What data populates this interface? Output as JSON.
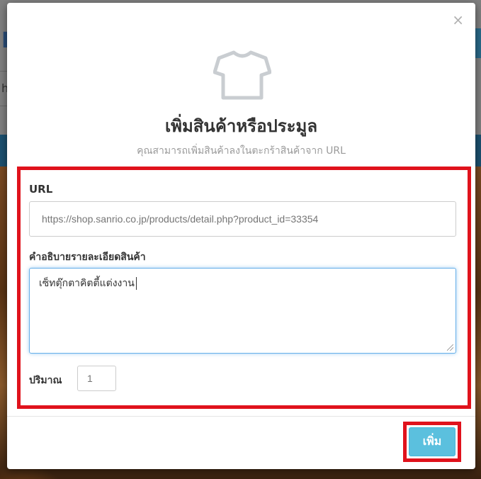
{
  "background": {
    "logo_letter": "F",
    "search_letter": "h"
  },
  "modal": {
    "close_label": "×",
    "icon": "tshirt-icon",
    "title": "เพิ่มสินค้าหรือประมูล",
    "subtitle": "คุณสามารถเพิ่มสินค้าลงในตะกร้าสินค้าจาก URL",
    "url_label": "URL",
    "url_placeholder": "https://shop.sanrio.co.jp/products/detail.php?product_id=33354",
    "desc_label": "คำอธิบายรายละเอียดสินค้า",
    "desc_value": "เซ็ทตุ๊กตาคิตตี้แต่งงาน",
    "qty_label": "ปริมาณ",
    "qty_placeholder": "1",
    "add_button_label": "เพิ่ม"
  },
  "colors": {
    "highlight_border": "#e0121c",
    "add_button": "#5bc0de",
    "focus_border": "#66afe9"
  }
}
